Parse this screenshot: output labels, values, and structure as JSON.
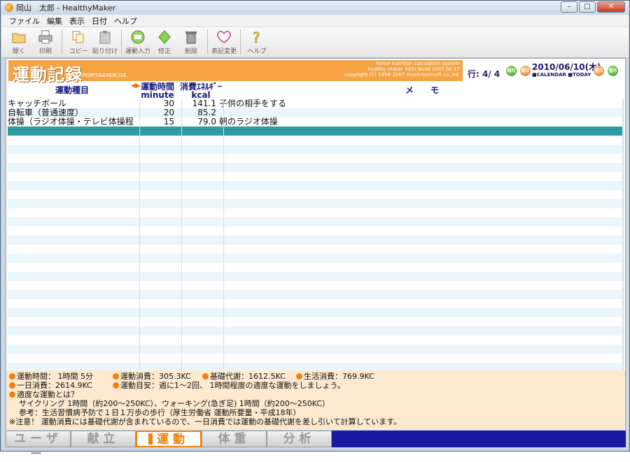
{
  "window": {
    "title": "岡山　太郎 - HealthyMaker"
  },
  "menu": [
    "ファイル",
    "編集",
    "表示",
    "日付",
    "ヘルプ"
  ],
  "toolbar": [
    "開く",
    "印刷",
    "コピー",
    "貼り付け",
    "運動入力",
    "修正",
    "削除",
    "表記変更",
    "ヘルプ"
  ],
  "banner": {
    "title": "運動記録",
    "subtitle": "SPORTS&EXERCISE",
    "info1": "home nutrition calculation system",
    "info2": "healthy maker 432c build 2007.02.17",
    "info3": "copyright (C) 1996-2007 mushroomsoft co.,ltd."
  },
  "nav": {
    "row_label": "行: 4/ 4",
    "prev_month": "前月",
    "prev_day": "前日",
    "date": "2010/06/10(木)",
    "calendar": "CALENDAR",
    "today": "TODAY",
    "next_day": "翌日",
    "next_month": "翌月"
  },
  "table": {
    "headers": {
      "name": "運動種目",
      "minutes": "運動時間",
      "minutes_unit": "minute",
      "kcal": "消費ｴﾈﾙｷﾞｰ",
      "kcal_unit": "kcal",
      "memo": "メ　　モ"
    },
    "rows": [
      {
        "name": "キャッチボール",
        "minutes": "30",
        "kcal": "141.1",
        "memo": "子供の相手をする"
      },
      {
        "name": "自転車（普通速度）",
        "minutes": "20",
        "kcal": "85.2",
        "memo": ""
      },
      {
        "name": "体操（ラジオ体操・テレビ体操程",
        "minutes": "15",
        "kcal": "79.0",
        "memo": "朝のラジオ体操"
      }
    ]
  },
  "summary": {
    "exercise_time": "運動時間： 1時間 5分",
    "exercise_kcal": "運動消費：305.3KC",
    "basal": "基礎代謝：1612.5KC",
    "life": "生活消費：769.9KC",
    "daily": "一日消費：2614.9KC",
    "guide": "運動目安：週に1〜2回、 1時間程度の適度な運動をしましょう。",
    "question": "適度な運動とは？",
    "example": "サイクリング 1時間（約200〜250KC）、ウォーキング(急ぎ足) 1時間（約200〜250KC）",
    "reference": "参考：生活習慣病予防で１日１万歩の歩行（厚生労働省 運動所要量・平成18年）",
    "note": "※注意！ 運動消費には基礎代謝が含まれているので、一日消費では運動の基礎代謝を差し引いて計算しています。"
  },
  "tabs": [
    "ユーザー",
    "献立",
    "運動",
    "体重",
    "分析"
  ],
  "colors": {
    "accent": "#f08010",
    "selected_row": "#2f9aa2",
    "tabbar": "#1a1aa0"
  }
}
